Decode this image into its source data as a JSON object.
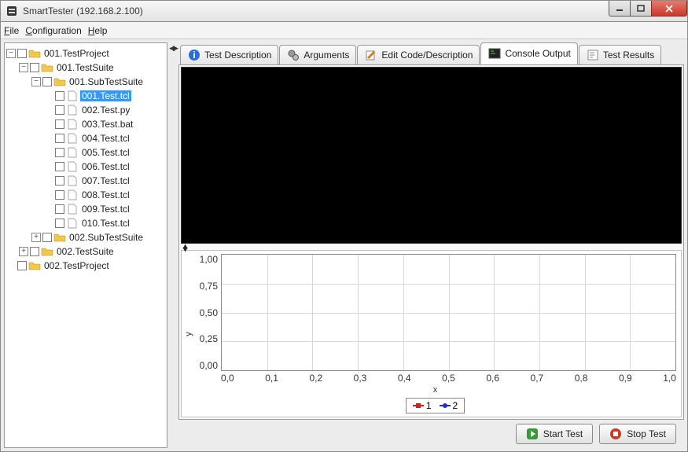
{
  "window": {
    "title": "SmartTester (192.168.2.100)"
  },
  "menu": {
    "file": "File",
    "config": "Configuration",
    "help": "Help"
  },
  "tree": {
    "n0": "001.TestProject",
    "n1": "001.TestSuite",
    "n2": "001.SubTestSuite",
    "files": [
      "001.Test.tcl",
      "002.Test.py",
      "003.Test.bat",
      "004.Test.tcl",
      "005.Test.tcl",
      "006.Test.tcl",
      "007.Test.tcl",
      "008.Test.tcl",
      "009.Test.tcl",
      "010.Test.tcl"
    ],
    "n3": "002.SubTestSuite",
    "n4": "002.TestSuite",
    "n5": "002.TestProject"
  },
  "tabs": {
    "desc": "Test Description",
    "args": "Arguments",
    "edit": "Edit Code/Description",
    "console": "Console Output",
    "results": "Test Results"
  },
  "chart_data": {
    "type": "line",
    "title": "",
    "xlabel": "x",
    "ylabel": "y",
    "xlim": [
      0.0,
      1.0
    ],
    "ylim": [
      0.0,
      1.0
    ],
    "xticks": [
      "0,0",
      "0,1",
      "0,2",
      "0,3",
      "0,4",
      "0,5",
      "0,6",
      "0,7",
      "0,8",
      "0,9",
      "1,0"
    ],
    "yticks": [
      "0,00",
      "0,25",
      "0,50",
      "0,75",
      "1,00"
    ],
    "series": [
      {
        "name": "1",
        "values": []
      },
      {
        "name": "2",
        "values": []
      }
    ]
  },
  "buttons": {
    "start": "Start Test",
    "stop": "Stop Test"
  }
}
